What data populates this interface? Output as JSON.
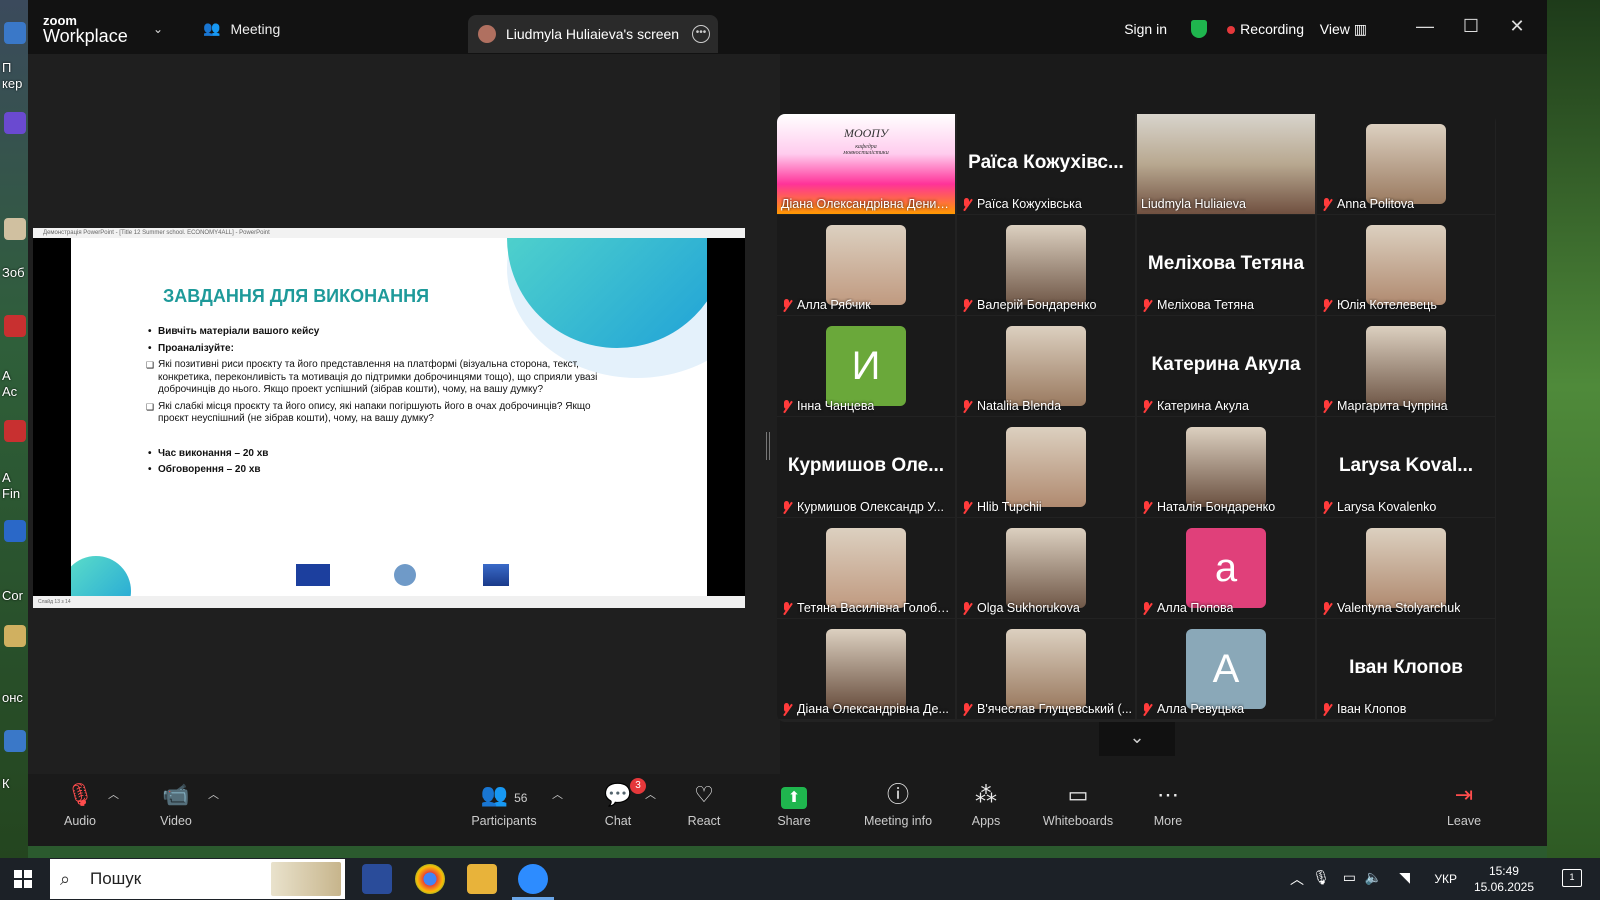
{
  "zoom": {
    "logo_line1": "zoom",
    "logo_line2": "Workplace",
    "meeting_label": "Meeting",
    "share_tab_label": "Liudmyla Huliaieva's screen",
    "sign_in": "Sign in",
    "recording": "Recording",
    "view": "View"
  },
  "slide": {
    "window_title": "Демонстрація PowerPoint - [Title 12 Summer school. ECONOMY4ALL] - PowerPoint",
    "status": "Слайд 13 з 14",
    "title": "ЗАВДАННЯ ДЛЯ ВИКОНАННЯ",
    "bullet1": "Вивчіть матеріали вашого кейсу",
    "bullet2": "Проаналізуйте:",
    "sq1": "Які позитивні риси проєкту та його представлення на платформі (візуальна сторона, текст, конкретика, переконливість та мотивація до підтримки доброчинцями тощо), що сприяли увазі доброчинців до нього. Якщо проект успішний (зібрав кошти), чому, на вашу думку?",
    "sq2": "Які слабкі місця проєкту та його опису, які напаки погіршують його в очах доброчинців? Якщо проєкт неуспішний (не зібрав кошти), чому, на вашу думку?",
    "bullet3": "Час виконання – 20 хв",
    "bullet4": "Обговорення – 20 хв"
  },
  "gallery": {
    "tiles": [
      {
        "name": "Діана Олександрівна Денис...",
        "big": "",
        "type": "logo",
        "logo_text": "МООПУ",
        "logo_sub": "кафедра\nмовностилістики",
        "muted": false
      },
      {
        "name": "Раїса Кожухівська",
        "big": "Раїса Кожухівс...",
        "type": "text",
        "muted": true
      },
      {
        "name": "Liudmyla Huliaieva",
        "big": "",
        "type": "video",
        "muted": false,
        "active": true
      },
      {
        "name": "Anna Politova",
        "big": "",
        "type": "photo",
        "muted": true
      },
      {
        "name": "Алла Рябчик",
        "big": "",
        "type": "photo",
        "muted": true
      },
      {
        "name": "Валерій Бондаренко",
        "big": "",
        "type": "photo",
        "muted": true
      },
      {
        "name": "Меліхова Тетяна",
        "big": "Меліхова Тетяна",
        "type": "text",
        "muted": true
      },
      {
        "name": "Юлія Котелевець",
        "big": "",
        "type": "photo",
        "muted": true
      },
      {
        "name": "Інна Чанцева",
        "big": "",
        "type": "letter",
        "letter": "И",
        "color": "#6aa83a",
        "muted": true
      },
      {
        "name": "Nataliia Blenda",
        "big": "",
        "type": "photo",
        "muted": true
      },
      {
        "name": "Катерина Акула",
        "big": "Катерина Акула",
        "type": "text",
        "muted": true
      },
      {
        "name": "Маргарита Чупріна",
        "big": "",
        "type": "photo",
        "muted": true
      },
      {
        "name": "Курмишов Олександр У...",
        "big": "Курмишов Оле...",
        "type": "text",
        "muted": true
      },
      {
        "name": "Hlib Tupchii",
        "big": "",
        "type": "photo",
        "muted": true
      },
      {
        "name": "Наталія Бондаренко",
        "big": "",
        "type": "photo",
        "muted": true
      },
      {
        "name": "Larysa Kovalenko",
        "big": "Larysa Koval...",
        "type": "text",
        "muted": true
      },
      {
        "name": "Тетяна Василівна Голобо...",
        "big": "",
        "type": "photo",
        "muted": true
      },
      {
        "name": "Olga Sukhorukova",
        "big": "",
        "type": "photo",
        "muted": true
      },
      {
        "name": "Алла Попова",
        "big": "",
        "type": "letter",
        "letter": "a",
        "color": "#e0407a",
        "muted": true
      },
      {
        "name": "Valentyna Stolyarchuk",
        "big": "",
        "type": "photo",
        "muted": true
      },
      {
        "name": "Діана Олександрівна Де...",
        "big": "",
        "type": "photo",
        "muted": true
      },
      {
        "name": "В'ячеслав Глущевський (...",
        "big": "",
        "type": "photo",
        "muted": true
      },
      {
        "name": "Алла Ревуцька",
        "big": "",
        "type": "letter",
        "letter": "A",
        "color": "#8aa8b8",
        "muted": true
      },
      {
        "name": "Іван Клопов",
        "big": "Іван Клопов",
        "type": "text",
        "muted": true
      }
    ]
  },
  "toolbar": {
    "audio": "Audio",
    "video": "Video",
    "participants": "Participants",
    "participants_count": "56",
    "chat": "Chat",
    "chat_badge": "3",
    "react": "React",
    "share": "Share",
    "meeting_info": "Meeting info",
    "apps": "Apps",
    "whiteboards": "Whiteboards",
    "more": "More",
    "leave": "Leave"
  },
  "taskbar": {
    "search_placeholder": "Пошук",
    "lang": "УКР",
    "time": "15:49",
    "date": "15.06.2025",
    "notif_count": "1"
  },
  "desktop": {
    "labels": [
      "П",
      "кер",
      "Зоб",
      "А",
      "Ас",
      "А",
      "Fin",
      "Cor",
      "онс",
      "К"
    ]
  }
}
